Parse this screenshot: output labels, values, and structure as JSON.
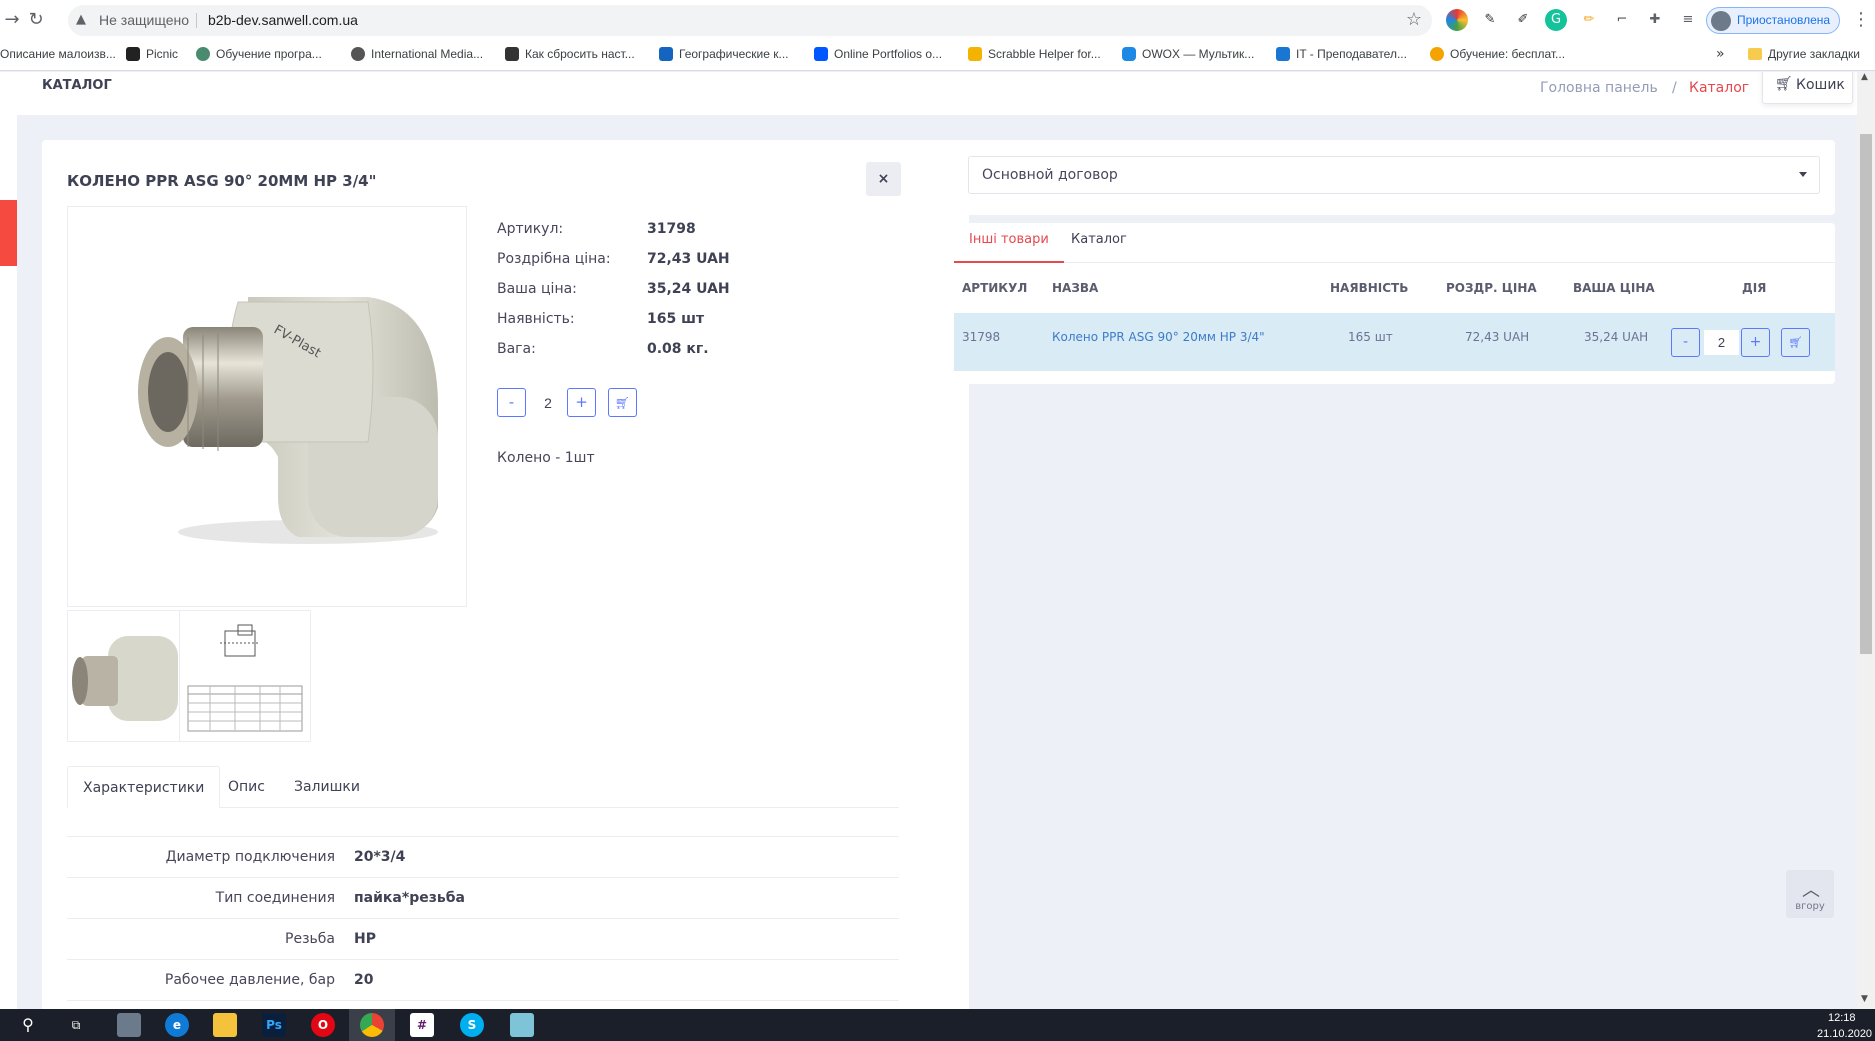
{
  "browser": {
    "security_label": "Не защищено",
    "url": "b2b-dev.sanwell.com.ua",
    "profile_label": "Приостановлена",
    "bookmarks": [
      "Описание малоизв...",
      "Picnic",
      "Обучение програ...",
      "International Media...",
      "Как сбросить наст...",
      "Географические к...",
      "Online Portfolios o...",
      "Scrabble Helper for...",
      "OWOX — Мультик...",
      "IT - Преподавател...",
      "Обучение: бесплат..."
    ],
    "bookmarks_more": "»",
    "other_bookmarks": "Другие закладки"
  },
  "subheader": {
    "title": "КАТАЛОГ",
    "crumb_home": "Головна панель",
    "crumb_sep": "/",
    "crumb_active": "Каталог",
    "cart_label": "Кошик"
  },
  "product": {
    "title": "КОЛЕНО PPR ASG 90° 20ММ НР 3/4\"",
    "close_label": "×",
    "attributes": [
      {
        "label": "Артикул:",
        "value": "31798"
      },
      {
        "label": "Роздрібна ціна:",
        "value": "72,43 UAH"
      },
      {
        "label": "Ваша ціна:",
        "value": "35,24 UAH"
      },
      {
        "label": "Наявність:",
        "value": "165 шт"
      },
      {
        "label": "Вага:",
        "value": "0.08 кг."
      }
    ],
    "qty_minus": "-",
    "qty_value": "2",
    "qty_plus": "+",
    "short_desc": "Колено - 1шт",
    "tabs": [
      "Характеристики",
      "Опис",
      "Залишки"
    ],
    "characteristics": [
      {
        "key": "Диаметр подключения",
        "value": "20*3/4"
      },
      {
        "key": "Тип соединения",
        "value": "пайка*резьба"
      },
      {
        "key": "Резьба",
        "value": "НР"
      },
      {
        "key": "Рабочее давление, бар",
        "value": "20"
      }
    ]
  },
  "contract": {
    "selected": "Основной договор"
  },
  "products_panel": {
    "tabs": [
      "Інші товари",
      "Каталог"
    ],
    "headers": [
      "АРТИКУЛ",
      "НАЗВА",
      "НАЯВНІСТЬ",
      "РОЗДР. ЦІНА",
      "ВАША ЦІНА",
      "ДІЯ"
    ],
    "rows": [
      {
        "sku": "31798",
        "name": "Колено PPR ASG 90° 20мм НР 3/4\"",
        "stock": "165 шт",
        "retail": "72,43 UAH",
        "price": "35,24 UAH",
        "qty": "2",
        "minus": "-",
        "plus": "+"
      }
    ]
  },
  "to_top_label": "вгору",
  "taskbar": {
    "time": "12:18",
    "date": "21.10.2020"
  },
  "colors": {
    "accent_red": "#e5484d",
    "accent_blue": "#5d78ff",
    "row_highlight": "#d9ebf5",
    "page_bg": "#eef0f8"
  }
}
